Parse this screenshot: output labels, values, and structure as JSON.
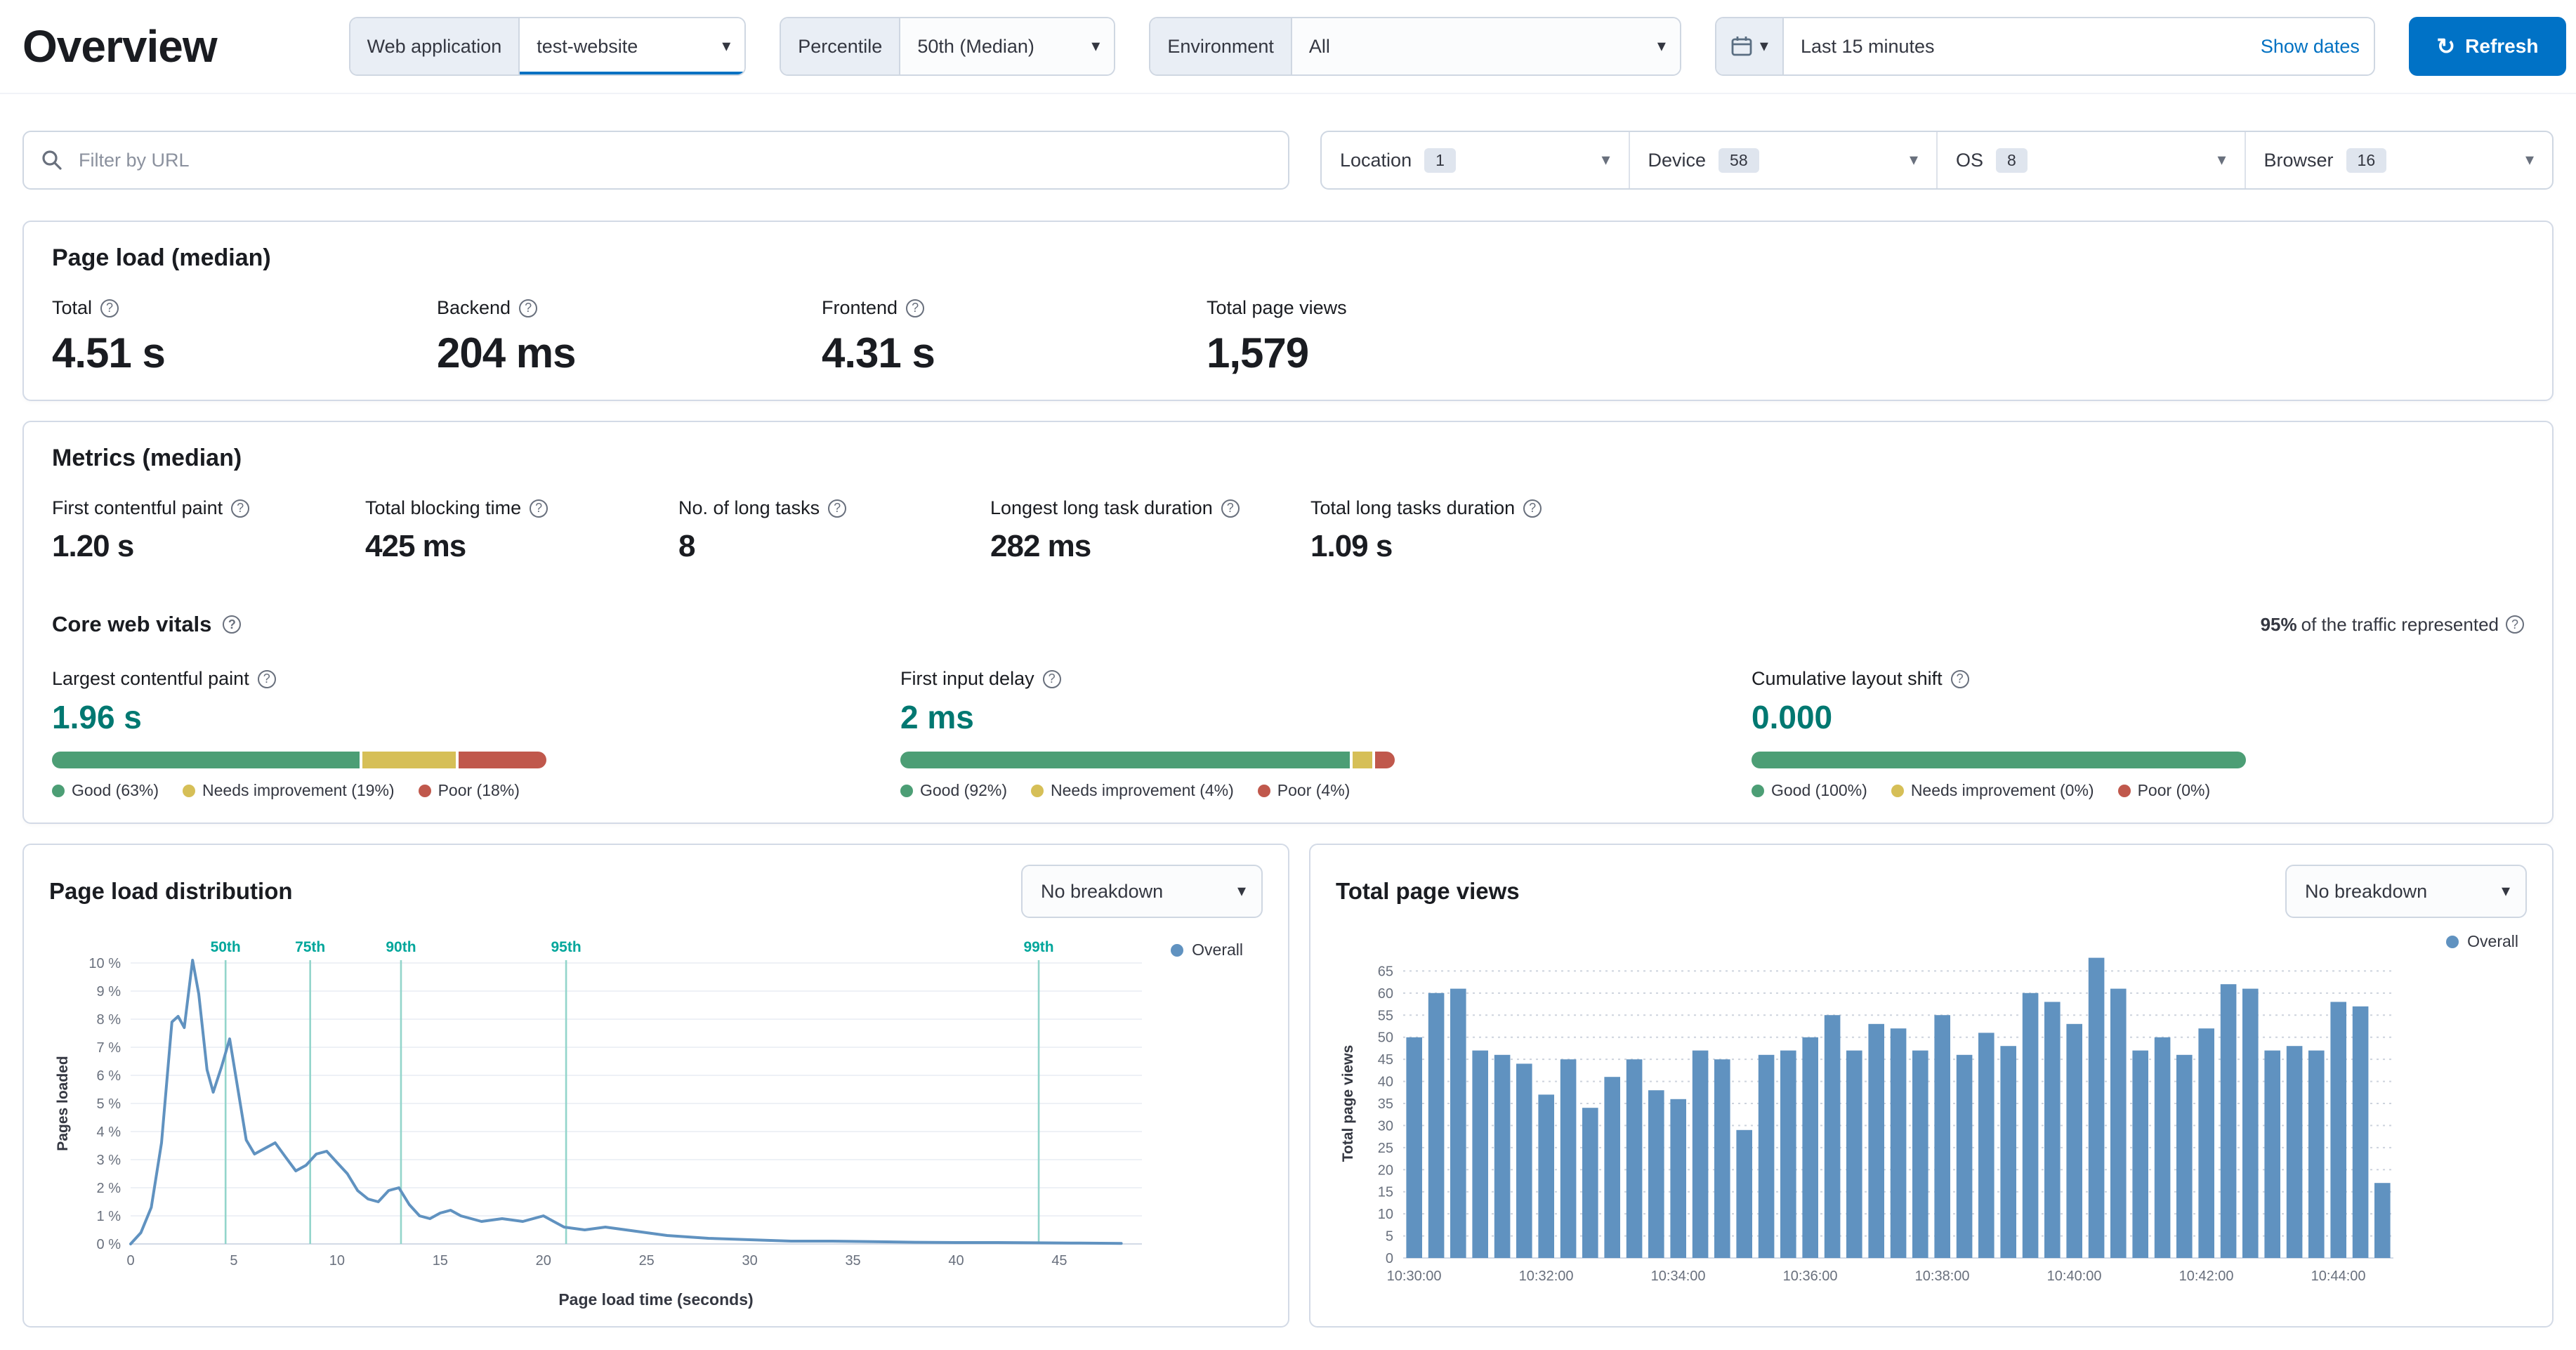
{
  "page_title": "Overview",
  "toolbar": {
    "web_application": {
      "label": "Web application",
      "value": "test-website"
    },
    "percentile": {
      "label": "Percentile",
      "value": "50th (Median)"
    },
    "environment": {
      "label": "Environment",
      "value": "All"
    },
    "time_range": {
      "value": "Last 15 minutes",
      "show_dates": "Show dates"
    },
    "refresh_label": "Refresh"
  },
  "filters": {
    "url_placeholder": "Filter by URL",
    "selects": [
      {
        "label": "Location",
        "count": "1"
      },
      {
        "label": "Device",
        "count": "58"
      },
      {
        "label": "OS",
        "count": "8"
      },
      {
        "label": "Browser",
        "count": "16"
      }
    ]
  },
  "page_load_panel": {
    "title": "Page load (median)",
    "metrics": [
      {
        "label": "Total",
        "value": "4.51 s"
      },
      {
        "label": "Backend",
        "value": "204 ms"
      },
      {
        "label": "Frontend",
        "value": "4.31 s"
      },
      {
        "label": "Total page views",
        "value": "1,579"
      }
    ]
  },
  "metrics_panel": {
    "title": "Metrics (median)",
    "metrics": [
      {
        "label": "First contentful paint",
        "value": "1.20 s"
      },
      {
        "label": "Total blocking time",
        "value": "425 ms"
      },
      {
        "label": "No. of long tasks",
        "value": "8"
      },
      {
        "label": "Longest long task duration",
        "value": "282 ms"
      },
      {
        "label": "Total long tasks duration",
        "value": "1.09 s"
      }
    ]
  },
  "core_web_vitals": {
    "title": "Core web vitals",
    "traffic_percent": "95%",
    "traffic_note": " of the traffic represented",
    "colors": {
      "good": "#4c9e75",
      "needs_improvement": "#d6bf57",
      "poor": "#c0584c"
    },
    "vitals": [
      {
        "label": "Largest contentful paint",
        "value": "1.96 s",
        "segments": [
          63,
          19,
          18
        ],
        "legend": [
          "Good (63%)",
          "Needs improvement (19%)",
          "Poor (18%)"
        ]
      },
      {
        "label": "First input delay",
        "value": "2 ms",
        "segments": [
          92,
          4,
          4
        ],
        "legend": [
          "Good (92%)",
          "Needs improvement (4%)",
          "Poor (4%)"
        ]
      },
      {
        "label": "Cumulative layout shift",
        "value": "0.000",
        "segments": [
          100,
          0,
          0
        ],
        "legend": [
          "Good (100%)",
          "Needs improvement (0%)",
          "Poor (0%)"
        ]
      }
    ]
  },
  "charts": {
    "breakdown_label": "No breakdown",
    "legend_overall": "Overall"
  },
  "chart_data": [
    {
      "type": "line",
      "title": "Page load distribution",
      "xlabel": "Page load time (seconds)",
      "ylabel": "Pages loaded",
      "xlim": [
        0,
        49
      ],
      "ylim": [
        0,
        10
      ],
      "x_ticks": [
        0,
        5,
        10,
        15,
        20,
        25,
        30,
        35,
        40,
        45
      ],
      "y_tick_suffix": " %",
      "legend_position": "top-right",
      "percentile_markers": [
        {
          "label": "50th",
          "x": 4.6
        },
        {
          "label": "75th",
          "x": 8.7
        },
        {
          "label": "90th",
          "x": 13.1
        },
        {
          "label": "95th",
          "x": 21.1
        },
        {
          "label": "99th",
          "x": 44.0
        }
      ],
      "series": [
        {
          "name": "Overall",
          "color": "#6092c0",
          "points": [
            [
              0,
              0
            ],
            [
              0.5,
              0.4
            ],
            [
              1,
              1.3
            ],
            [
              1.5,
              3.6
            ],
            [
              2,
              7.9
            ],
            [
              2.3,
              8.1
            ],
            [
              2.6,
              7.7
            ],
            [
              3,
              10.1
            ],
            [
              3.3,
              8.9
            ],
            [
              3.7,
              6.2
            ],
            [
              4,
              5.4
            ],
            [
              4.4,
              6.3
            ],
            [
              4.8,
              7.3
            ],
            [
              5.2,
              5.5
            ],
            [
              5.6,
              3.7
            ],
            [
              6,
              3.2
            ],
            [
              6.5,
              3.4
            ],
            [
              7,
              3.6
            ],
            [
              7.5,
              3.1
            ],
            [
              8,
              2.6
            ],
            [
              8.5,
              2.8
            ],
            [
              9,
              3.2
            ],
            [
              9.5,
              3.3
            ],
            [
              10,
              2.9
            ],
            [
              10.5,
              2.5
            ],
            [
              11,
              1.9
            ],
            [
              11.5,
              1.6
            ],
            [
              12,
              1.5
            ],
            [
              12.5,
              1.9
            ],
            [
              13,
              2.0
            ],
            [
              13.5,
              1.4
            ],
            [
              14,
              1.0
            ],
            [
              14.5,
              0.9
            ],
            [
              15,
              1.1
            ],
            [
              15.5,
              1.2
            ],
            [
              16,
              1.0
            ],
            [
              17,
              0.8
            ],
            [
              18,
              0.9
            ],
            [
              19,
              0.8
            ],
            [
              20,
              1.0
            ],
            [
              20.5,
              0.8
            ],
            [
              21,
              0.6
            ],
            [
              22,
              0.5
            ],
            [
              23,
              0.6
            ],
            [
              24,
              0.5
            ],
            [
              25,
              0.4
            ],
            [
              26,
              0.3
            ],
            [
              27,
              0.25
            ],
            [
              28,
              0.2
            ],
            [
              30,
              0.15
            ],
            [
              32,
              0.1
            ],
            [
              34,
              0.1
            ],
            [
              36,
              0.08
            ],
            [
              38,
              0.06
            ],
            [
              40,
              0.05
            ],
            [
              42,
              0.05
            ],
            [
              44,
              0.04
            ],
            [
              46,
              0.03
            ],
            [
              48,
              0.02
            ]
          ]
        }
      ]
    },
    {
      "type": "bar",
      "title": "Total page views",
      "ylabel": "Total page views",
      "ylim": [
        0,
        70
      ],
      "y_ticks": [
        0,
        5,
        10,
        15,
        20,
        25,
        30,
        35,
        40,
        45,
        50,
        55,
        60,
        65
      ],
      "x_tick_labels": [
        "10:30:00",
        "10:32:00",
        "10:34:00",
        "10:36:00",
        "10:38:00",
        "10:40:00",
        "10:42:00",
        "10:44:00"
      ],
      "x_tick_every": 6,
      "grid": "dotted",
      "series": [
        {
          "name": "Overall",
          "color": "#6092c0",
          "values": [
            50,
            60,
            61,
            47,
            46,
            44,
            37,
            45,
            34,
            41,
            45,
            38,
            36,
            47,
            45,
            29,
            46,
            47,
            50,
            55,
            47,
            53,
            52,
            47,
            55,
            46,
            51,
            48,
            60,
            58,
            53,
            68,
            61,
            47,
            50,
            46,
            52,
            62,
            61,
            47,
            48,
            47,
            58,
            57,
            17
          ]
        }
      ]
    }
  ]
}
